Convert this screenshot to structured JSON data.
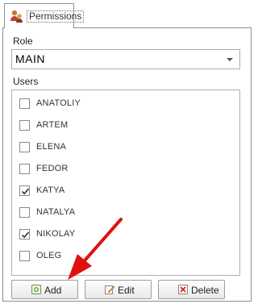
{
  "tab": {
    "label": "Permissions",
    "icon": "users-key-icon"
  },
  "role": {
    "label": "Role",
    "value": "MAIN"
  },
  "users": {
    "label": "Users",
    "items": [
      {
        "name": "ANATOLIY",
        "checked": false
      },
      {
        "name": "ARTEM",
        "checked": false
      },
      {
        "name": "ELENA",
        "checked": false
      },
      {
        "name": "FEDOR",
        "checked": false
      },
      {
        "name": "KATYA",
        "checked": true
      },
      {
        "name": "NATALYA",
        "checked": false
      },
      {
        "name": "NIKOLAY",
        "checked": true
      },
      {
        "name": "OLEG",
        "checked": false
      }
    ]
  },
  "buttons": {
    "add_label": "Add",
    "edit_label": "Edit",
    "delete_label": "Delete"
  },
  "colors": {
    "annotation_arrow": "#e01010"
  }
}
